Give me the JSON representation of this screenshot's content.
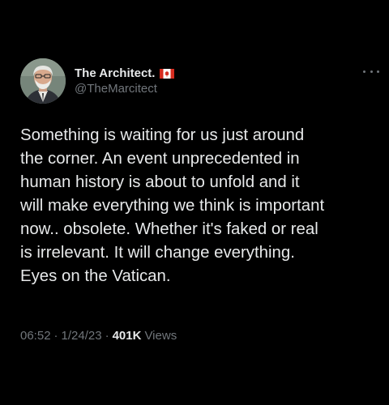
{
  "author": {
    "display_name": "The Architect.",
    "handle": "@TheMarcitect",
    "badge_icon": "canada-flag-icon",
    "avatar_icon": "profile-photo"
  },
  "more_icon": "more-horizontal-icon",
  "tweet": {
    "text": "Something is waiting for us just around\nthe corner. An event unprecedented in\nhuman history is about to unfold and it\nwill make everything we think is important\nnow.. obsolete. Whether it's faked or real\nis irrelevant. It will change everything.\nEyes on the Vatican."
  },
  "meta": {
    "time": "06:52",
    "separator": "·",
    "date": "1/24/23",
    "views_count": "401K",
    "views_label": "Views"
  },
  "colors": {
    "background": "#000000",
    "primary_text": "#e7e9ea",
    "secondary_text": "#71767b",
    "flag_red": "#d52b1e"
  }
}
